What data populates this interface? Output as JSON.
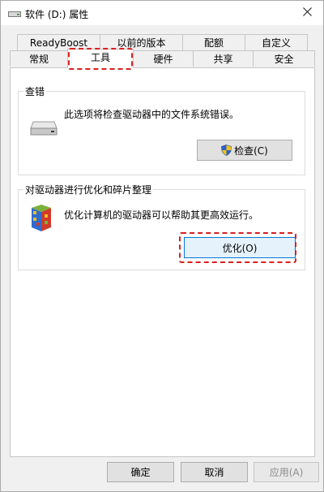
{
  "window": {
    "title": "软件 (D:) 属性"
  },
  "tabs_row1": [
    {
      "label": "ReadyBoost"
    },
    {
      "label": "以前的版本"
    },
    {
      "label": "配额"
    },
    {
      "label": "自定义"
    }
  ],
  "tabs_row2": [
    {
      "label": "常规"
    },
    {
      "label": "工具",
      "active": true
    },
    {
      "label": "硬件"
    },
    {
      "label": "共享"
    },
    {
      "label": "安全"
    }
  ],
  "error_check": {
    "title": "查错",
    "description": "此选项将检查驱动器中的文件系统错误。",
    "button": "检查(C)"
  },
  "optimize": {
    "title": "对驱动器进行优化和碎片整理",
    "description": "优化计算机的驱动器可以帮助其更高效运行。",
    "button": "优化(O)"
  },
  "footer": {
    "ok": "确定",
    "cancel": "取消",
    "apply": "应用(A)"
  },
  "colors": {
    "highlight_dash": "#d82020",
    "focus_blue": "#0078d7"
  }
}
